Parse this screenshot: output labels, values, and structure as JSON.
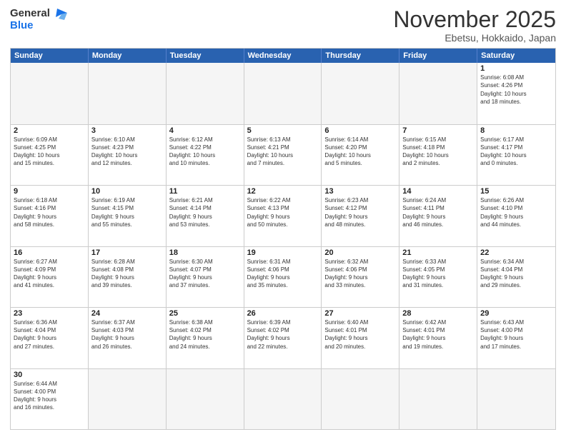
{
  "header": {
    "logo_general": "General",
    "logo_blue": "Blue",
    "month_title": "November 2025",
    "subtitle": "Ebetsu, Hokkaido, Japan"
  },
  "weekdays": [
    "Sunday",
    "Monday",
    "Tuesday",
    "Wednesday",
    "Thursday",
    "Friday",
    "Saturday"
  ],
  "rows": [
    [
      {
        "day": "",
        "info": "",
        "empty": true
      },
      {
        "day": "",
        "info": "",
        "empty": true
      },
      {
        "day": "",
        "info": "",
        "empty": true
      },
      {
        "day": "",
        "info": "",
        "empty": true
      },
      {
        "day": "",
        "info": "",
        "empty": true
      },
      {
        "day": "",
        "info": "",
        "empty": true
      },
      {
        "day": "1",
        "info": "Sunrise: 6:08 AM\nSunset: 4:26 PM\nDaylight: 10 hours\nand 18 minutes.",
        "empty": false
      }
    ],
    [
      {
        "day": "2",
        "info": "Sunrise: 6:09 AM\nSunset: 4:25 PM\nDaylight: 10 hours\nand 15 minutes.",
        "empty": false
      },
      {
        "day": "3",
        "info": "Sunrise: 6:10 AM\nSunset: 4:23 PM\nDaylight: 10 hours\nand 12 minutes.",
        "empty": false
      },
      {
        "day": "4",
        "info": "Sunrise: 6:12 AM\nSunset: 4:22 PM\nDaylight: 10 hours\nand 10 minutes.",
        "empty": false
      },
      {
        "day": "5",
        "info": "Sunrise: 6:13 AM\nSunset: 4:21 PM\nDaylight: 10 hours\nand 7 minutes.",
        "empty": false
      },
      {
        "day": "6",
        "info": "Sunrise: 6:14 AM\nSunset: 4:20 PM\nDaylight: 10 hours\nand 5 minutes.",
        "empty": false
      },
      {
        "day": "7",
        "info": "Sunrise: 6:15 AM\nSunset: 4:18 PM\nDaylight: 10 hours\nand 2 minutes.",
        "empty": false
      },
      {
        "day": "8",
        "info": "Sunrise: 6:17 AM\nSunset: 4:17 PM\nDaylight: 10 hours\nand 0 minutes.",
        "empty": false
      }
    ],
    [
      {
        "day": "9",
        "info": "Sunrise: 6:18 AM\nSunset: 4:16 PM\nDaylight: 9 hours\nand 58 minutes.",
        "empty": false
      },
      {
        "day": "10",
        "info": "Sunrise: 6:19 AM\nSunset: 4:15 PM\nDaylight: 9 hours\nand 55 minutes.",
        "empty": false
      },
      {
        "day": "11",
        "info": "Sunrise: 6:21 AM\nSunset: 4:14 PM\nDaylight: 9 hours\nand 53 minutes.",
        "empty": false
      },
      {
        "day": "12",
        "info": "Sunrise: 6:22 AM\nSunset: 4:13 PM\nDaylight: 9 hours\nand 50 minutes.",
        "empty": false
      },
      {
        "day": "13",
        "info": "Sunrise: 6:23 AM\nSunset: 4:12 PM\nDaylight: 9 hours\nand 48 minutes.",
        "empty": false
      },
      {
        "day": "14",
        "info": "Sunrise: 6:24 AM\nSunset: 4:11 PM\nDaylight: 9 hours\nand 46 minutes.",
        "empty": false
      },
      {
        "day": "15",
        "info": "Sunrise: 6:26 AM\nSunset: 4:10 PM\nDaylight: 9 hours\nand 44 minutes.",
        "empty": false
      }
    ],
    [
      {
        "day": "16",
        "info": "Sunrise: 6:27 AM\nSunset: 4:09 PM\nDaylight: 9 hours\nand 41 minutes.",
        "empty": false
      },
      {
        "day": "17",
        "info": "Sunrise: 6:28 AM\nSunset: 4:08 PM\nDaylight: 9 hours\nand 39 minutes.",
        "empty": false
      },
      {
        "day": "18",
        "info": "Sunrise: 6:30 AM\nSunset: 4:07 PM\nDaylight: 9 hours\nand 37 minutes.",
        "empty": false
      },
      {
        "day": "19",
        "info": "Sunrise: 6:31 AM\nSunset: 4:06 PM\nDaylight: 9 hours\nand 35 minutes.",
        "empty": false
      },
      {
        "day": "20",
        "info": "Sunrise: 6:32 AM\nSunset: 4:06 PM\nDaylight: 9 hours\nand 33 minutes.",
        "empty": false
      },
      {
        "day": "21",
        "info": "Sunrise: 6:33 AM\nSunset: 4:05 PM\nDaylight: 9 hours\nand 31 minutes.",
        "empty": false
      },
      {
        "day": "22",
        "info": "Sunrise: 6:34 AM\nSunset: 4:04 PM\nDaylight: 9 hours\nand 29 minutes.",
        "empty": false
      }
    ],
    [
      {
        "day": "23",
        "info": "Sunrise: 6:36 AM\nSunset: 4:04 PM\nDaylight: 9 hours\nand 27 minutes.",
        "empty": false
      },
      {
        "day": "24",
        "info": "Sunrise: 6:37 AM\nSunset: 4:03 PM\nDaylight: 9 hours\nand 26 minutes.",
        "empty": false
      },
      {
        "day": "25",
        "info": "Sunrise: 6:38 AM\nSunset: 4:02 PM\nDaylight: 9 hours\nand 24 minutes.",
        "empty": false
      },
      {
        "day": "26",
        "info": "Sunrise: 6:39 AM\nSunset: 4:02 PM\nDaylight: 9 hours\nand 22 minutes.",
        "empty": false
      },
      {
        "day": "27",
        "info": "Sunrise: 6:40 AM\nSunset: 4:01 PM\nDaylight: 9 hours\nand 20 minutes.",
        "empty": false
      },
      {
        "day": "28",
        "info": "Sunrise: 6:42 AM\nSunset: 4:01 PM\nDaylight: 9 hours\nand 19 minutes.",
        "empty": false
      },
      {
        "day": "29",
        "info": "Sunrise: 6:43 AM\nSunset: 4:00 PM\nDaylight: 9 hours\nand 17 minutes.",
        "empty": false
      }
    ],
    [
      {
        "day": "30",
        "info": "Sunrise: 6:44 AM\nSunset: 4:00 PM\nDaylight: 9 hours\nand 16 minutes.",
        "empty": false
      },
      {
        "day": "",
        "info": "",
        "empty": true
      },
      {
        "day": "",
        "info": "",
        "empty": true
      },
      {
        "day": "",
        "info": "",
        "empty": true
      },
      {
        "day": "",
        "info": "",
        "empty": true
      },
      {
        "day": "",
        "info": "",
        "empty": true
      },
      {
        "day": "",
        "info": "",
        "empty": true
      }
    ]
  ]
}
